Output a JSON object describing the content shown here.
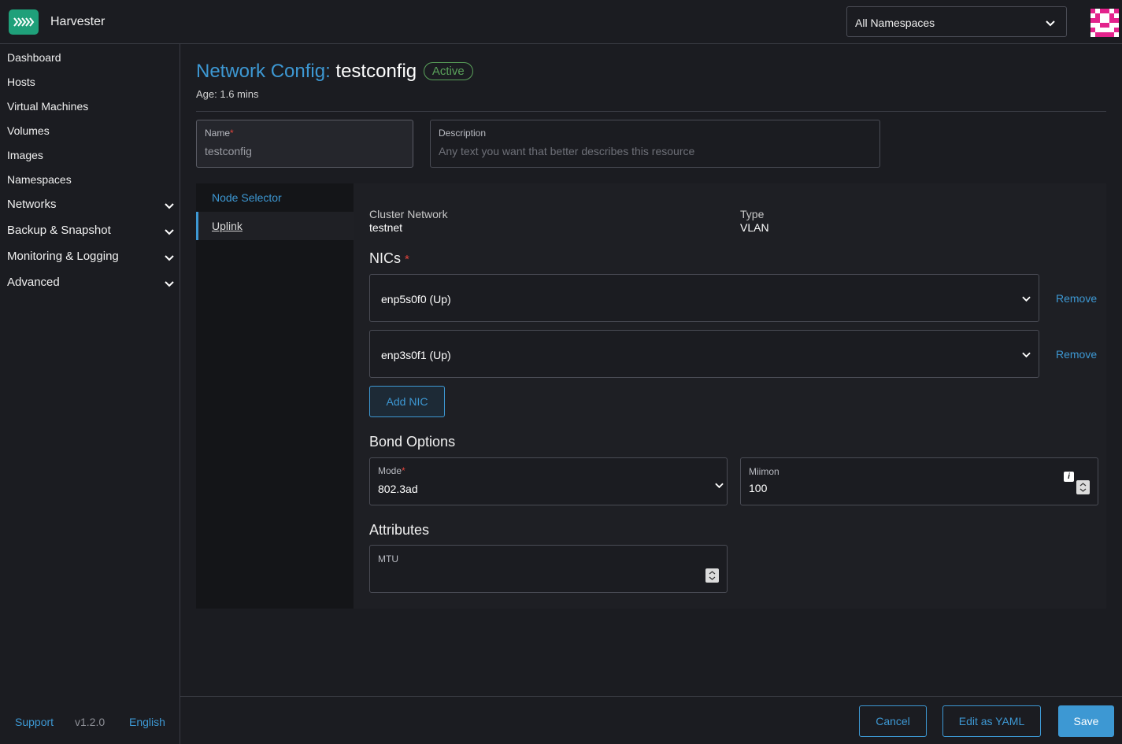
{
  "app": {
    "title": "Harvester"
  },
  "header": {
    "namespace_select": "All Namespaces"
  },
  "sidebar": {
    "items": [
      {
        "label": "Dashboard"
      },
      {
        "label": "Hosts"
      },
      {
        "label": "Virtual Machines"
      },
      {
        "label": "Volumes"
      },
      {
        "label": "Images"
      },
      {
        "label": "Namespaces"
      },
      {
        "label": "Networks"
      },
      {
        "label": "Backup & Snapshot"
      },
      {
        "label": "Monitoring & Logging"
      },
      {
        "label": "Advanced"
      }
    ],
    "footer": {
      "support": "Support",
      "version": "v1.2.0",
      "language": "English"
    }
  },
  "page": {
    "kind": "Network Config:",
    "name": "testconfig",
    "status": "Active",
    "age": "Age: 1.6 mins"
  },
  "form": {
    "name": {
      "label": "Name",
      "required_mark": "*",
      "value": "testconfig"
    },
    "description": {
      "label": "Description",
      "placeholder": "Any text you want that better describes this resource"
    }
  },
  "tabs": [
    {
      "label": "Node Selector"
    },
    {
      "label": "Uplink"
    }
  ],
  "uplink": {
    "cluster_network_label": "Cluster Network",
    "cluster_network_value": "testnet",
    "type_label": "Type",
    "type_value": "VLAN",
    "nics_heading": "NICs",
    "required_mark": "*",
    "nics": [
      {
        "value": "enp5s0f0 (Up)",
        "remove": "Remove"
      },
      {
        "value": "enp3s0f1 (Up)",
        "remove": "Remove"
      }
    ],
    "add_nic": "Add NIC",
    "bond_heading": "Bond Options",
    "mode": {
      "label": "Mode",
      "value": "802.3ad"
    },
    "miimon": {
      "label": "Miimon",
      "value": "100"
    },
    "attributes_heading": "Attributes",
    "mtu": {
      "label": "MTU",
      "value": ""
    }
  },
  "actions": {
    "cancel": "Cancel",
    "edit_yaml": "Edit as YAML",
    "save": "Save"
  },
  "colors": {
    "accent": "#3d98d3",
    "active": "#5aa15a",
    "required": "#e0443c",
    "brand": "#1fa07a"
  }
}
